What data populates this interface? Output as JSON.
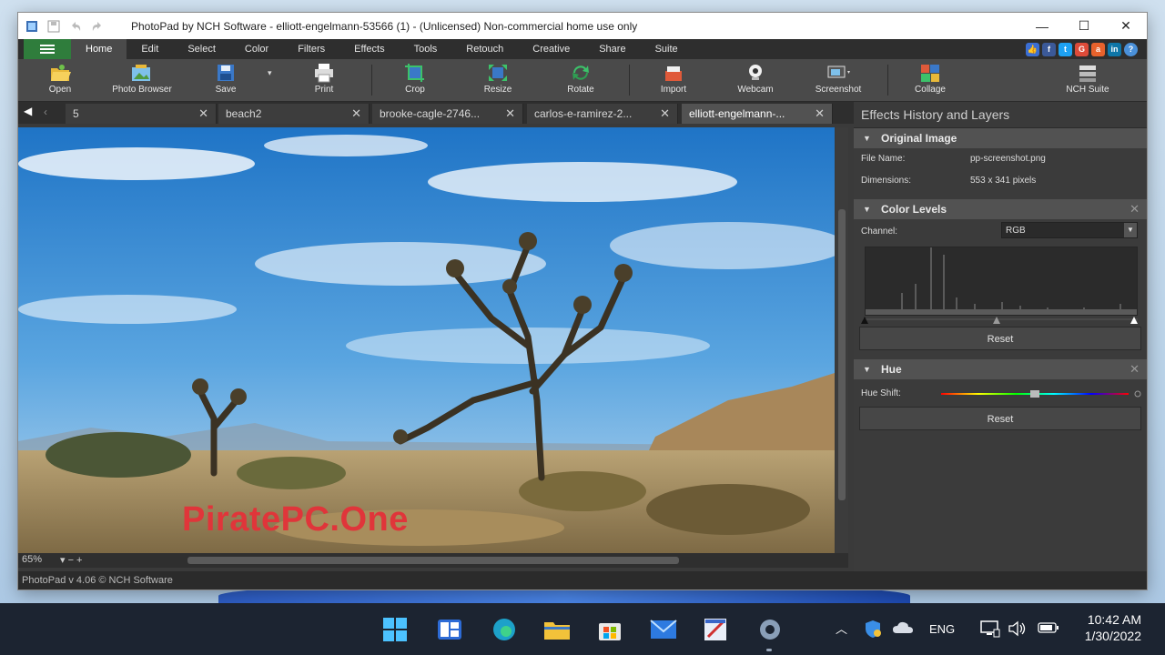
{
  "window": {
    "title": "PhotoPad by NCH Software - elliott-engelmann-53566 (1) - (Unlicensed) Non-commercial home use only",
    "controls": {
      "minimize": "—",
      "maximize": "☐",
      "close": "✕"
    }
  },
  "menu": {
    "tabs": [
      "Home",
      "Edit",
      "Select",
      "Color",
      "Filters",
      "Effects",
      "Tools",
      "Retouch",
      "Creative",
      "Share",
      "Suite"
    ],
    "active": "Home"
  },
  "toolbar": {
    "open": "Open",
    "photo_browser": "Photo Browser",
    "save": "Save",
    "print": "Print",
    "crop": "Crop",
    "resize": "Resize",
    "rotate": "Rotate",
    "import": "Import",
    "webcam": "Webcam",
    "screenshot": "Screenshot",
    "collage": "Collage",
    "nch_suite": "NCH Suite"
  },
  "doc_tabs": [
    {
      "label": "5"
    },
    {
      "label": "beach2"
    },
    {
      "label": "brooke-cagle-2746..."
    },
    {
      "label": "carlos-e-ramirez-2..."
    },
    {
      "label": "elliott-engelmann-..."
    }
  ],
  "canvas": {
    "zoom": "65%",
    "zoom_controls": "▾ − +"
  },
  "footer": {
    "version": "PhotoPad v 4.06 © NCH Software"
  },
  "panel": {
    "title": "Effects History and Layers",
    "original": {
      "header": "Original Image",
      "file_name_label": "File Name:",
      "file_name": "pp-screenshot.png",
      "dimensions_label": "Dimensions:",
      "dimensions": "553 x 341 pixels"
    },
    "levels": {
      "header": "Color Levels",
      "channel_label": "Channel:",
      "channel": "RGB",
      "reset": "Reset"
    },
    "hue": {
      "header": "Hue",
      "shift_label": "Hue Shift:",
      "reset": "Reset"
    }
  },
  "watermark": "PiratePC.One",
  "taskbar": {
    "language": "ENG",
    "time": "10:42 AM",
    "date": "1/30/2022"
  }
}
